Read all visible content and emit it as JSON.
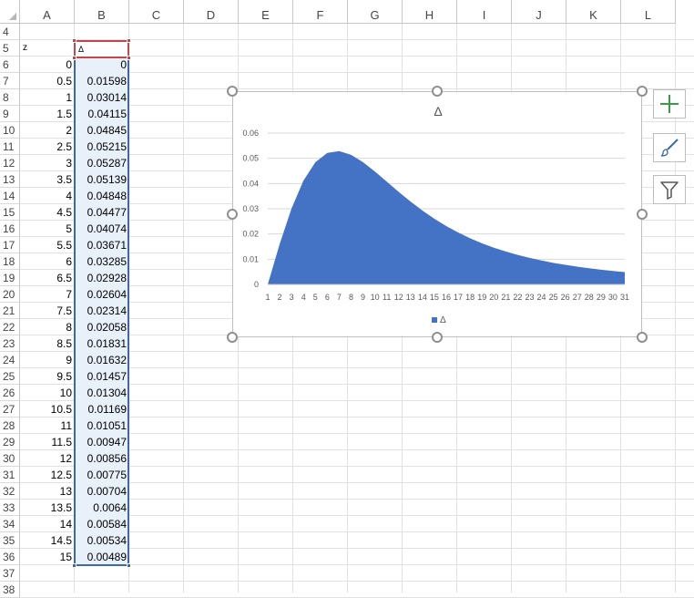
{
  "columns": [
    "A",
    "B",
    "C",
    "D",
    "E",
    "F",
    "G",
    "H",
    "I",
    "J",
    "K",
    "L"
  ],
  "rows": [
    "4",
    "5",
    "6",
    "7",
    "8",
    "9",
    "10",
    "11",
    "12",
    "13",
    "14",
    "15",
    "16",
    "17",
    "18",
    "19",
    "20",
    "21",
    "22",
    "23",
    "24",
    "25",
    "26",
    "27",
    "28",
    "29",
    "30",
    "31",
    "32",
    "33",
    "34",
    "35",
    "36",
    "37",
    "38"
  ],
  "cells": {
    "a5": "z",
    "b5": "Δ",
    "col_a": [
      "0",
      "0.5",
      "1",
      "1.5",
      "2",
      "2.5",
      "3",
      "3.5",
      "4",
      "4.5",
      "5",
      "5.5",
      "6",
      "6.5",
      "7",
      "7.5",
      "8",
      "8.5",
      "9",
      "9.5",
      "10",
      "10.5",
      "11",
      "11.5",
      "12",
      "12.5",
      "13",
      "13.5",
      "14",
      "14.5",
      "15"
    ],
    "col_b": [
      "0",
      "0.01598",
      "0.03014",
      "0.04115",
      "0.04845",
      "0.05215",
      "0.05287",
      "0.05139",
      "0.04848",
      "0.04477",
      "0.04074",
      "0.03671",
      "0.03285",
      "0.02928",
      "0.02604",
      "0.02314",
      "0.02058",
      "0.01831",
      "0.01632",
      "0.01457",
      "0.01304",
      "0.01169",
      "0.01051",
      "0.00947",
      "0.00856",
      "0.00775",
      "0.00704",
      "0.0064",
      "0.00584",
      "0.00534",
      "0.00489"
    ]
  },
  "chart": {
    "title": "Δ",
    "legend_label": "Δ",
    "series_color": "#4472c4"
  },
  "chart_data": {
    "type": "area",
    "title": "Δ",
    "xlabel": "",
    "ylabel": "",
    "categories": [
      "1",
      "2",
      "3",
      "4",
      "5",
      "6",
      "7",
      "8",
      "9",
      "10",
      "11",
      "12",
      "13",
      "14",
      "15",
      "16",
      "17",
      "18",
      "19",
      "20",
      "21",
      "22",
      "23",
      "24",
      "25",
      "26",
      "27",
      "28",
      "29",
      "30",
      "31"
    ],
    "series": [
      {
        "name": "Δ",
        "values": [
          0,
          0.01598,
          0.03014,
          0.04115,
          0.04845,
          0.05215,
          0.05287,
          0.05139,
          0.04848,
          0.04477,
          0.04074,
          0.03671,
          0.03285,
          0.02928,
          0.02604,
          0.02314,
          0.02058,
          0.01831,
          0.01632,
          0.01457,
          0.01304,
          0.01169,
          0.01051,
          0.00947,
          0.00856,
          0.00775,
          0.00704,
          0.0064,
          0.00584,
          0.00534,
          0.00489
        ]
      }
    ],
    "yticks": [
      "0",
      "0.01",
      "0.02",
      "0.03",
      "0.04",
      "0.05",
      "0.06"
    ],
    "ylim": [
      0,
      0.06
    ],
    "grid": true,
    "legend": "bottom"
  },
  "side_buttons": [
    {
      "icon": "plus-icon",
      "color": "#3a9b45"
    },
    {
      "icon": "brush-icon",
      "color": "#3d6aa6"
    },
    {
      "icon": "filter-icon",
      "color": "#555555"
    }
  ]
}
